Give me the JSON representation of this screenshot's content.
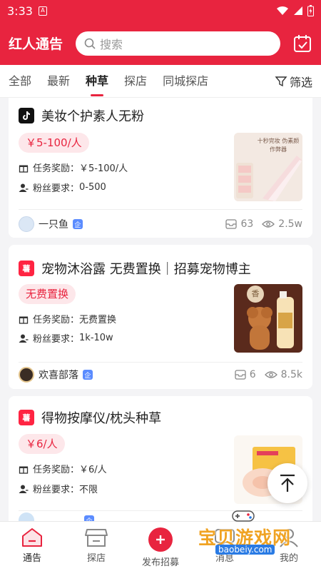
{
  "status": {
    "time": "3:33",
    "sim_label": "A"
  },
  "header": {
    "brand": "红人通告",
    "search_placeholder": "搜索"
  },
  "tabs": [
    {
      "label": "全部",
      "active": false
    },
    {
      "label": "最新",
      "active": false
    },
    {
      "label": "种草",
      "active": true
    },
    {
      "label": "探店",
      "active": false
    },
    {
      "label": "同城探店",
      "active": false
    }
  ],
  "filter_label": "筛选",
  "reward_label": "任务奖励：",
  "fans_label": "粉丝要求：",
  "cards": [
    {
      "platform": "douyin",
      "title": "美妆个护素人无粉",
      "tag": "￥5-100/人",
      "reward": "￥5-100/人",
      "fans": "0-500",
      "author": "一只鱼",
      "verified": "企",
      "apply_count": "63",
      "view_count": "2.5w",
      "thumb_text": "十秒完妆 伪素颜作弊器"
    },
    {
      "platform": "xiaohongshu",
      "platform_mark": "薯",
      "title": "宠物沐浴露 无费置换｜招募宠物博主",
      "tag": "无费置换",
      "reward": "无费置换",
      "fans": "1k-10w",
      "author": "欢喜部落",
      "verified": "企",
      "apply_count": "6",
      "view_count": "8.5k",
      "thumb_text": "香"
    },
    {
      "platform": "xiaohongshu",
      "platform_mark": "薯",
      "title": "得物按摩仪/枕头种草",
      "tag": "￥6/人",
      "reward": "￥6/人",
      "fans": "不限",
      "verified": "企"
    }
  ],
  "bottom_nav": [
    {
      "label": "通告",
      "icon": "notice-home-icon",
      "active": true
    },
    {
      "label": "探店",
      "icon": "store-icon",
      "active": false
    },
    {
      "label": "发布招募",
      "icon": "plus-icon",
      "active": false
    },
    {
      "label": "消息",
      "icon": "message-icon",
      "active": false
    },
    {
      "label": "我的",
      "icon": "profile-icon",
      "active": false
    }
  ],
  "watermark": {
    "text": "宝贝游戏网",
    "url": "baobeiy.com"
  },
  "colors": {
    "brand": "#e8243f",
    "tag_bg": "#fde7ea",
    "verified": "#5b8cff"
  }
}
